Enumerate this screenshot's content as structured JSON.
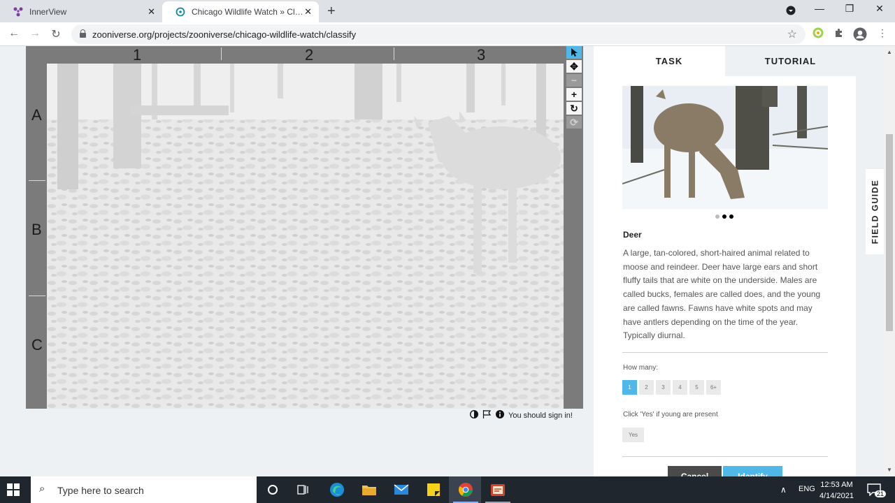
{
  "browser": {
    "tabs": [
      {
        "title": "InnerView",
        "active": false
      },
      {
        "title": "Chicago Wildlife Watch » Classify",
        "active": true
      }
    ],
    "url": "zooniverse.org/projects/zooniverse/chicago-wildlife-watch/classify"
  },
  "viewer": {
    "columns": [
      "1",
      "2",
      "3"
    ],
    "rows": [
      "A",
      "B",
      "C"
    ],
    "sign_in_text": "You should sign in!"
  },
  "panel": {
    "tabs": [
      "TASK",
      "TUTORIAL"
    ],
    "field_guide_label": "FIELD GUIDE",
    "species": "Deer",
    "description": "A large, tan-colored, short-haired animal related to moose and reindeer. Deer have large ears and short fluffy tails that are white on the underside. Males are called bucks, females are called does, and the young are called fawns. Fawns have white spots and may have antlers depending on the time of the year. Typically diurnal.",
    "how_many_label": "How many:",
    "counts": [
      "1",
      "2",
      "3",
      "4",
      "5",
      "6+"
    ],
    "selected_count": "1",
    "young_label": "Click 'Yes' if young are present",
    "yes_label": "Yes",
    "cancel_label": "Cancel",
    "identify_label": "Identify"
  },
  "taskbar": {
    "search_placeholder": "Type here to search",
    "language": "ENG",
    "time": "12:53 AM",
    "date": "4/14/2021",
    "notification_count": "21"
  },
  "colors": {
    "accent": "#4fb8e8",
    "viewer_frame": "#7b7b7b",
    "cancel": "#4a4a4a",
    "taskbar": "#20262e"
  }
}
